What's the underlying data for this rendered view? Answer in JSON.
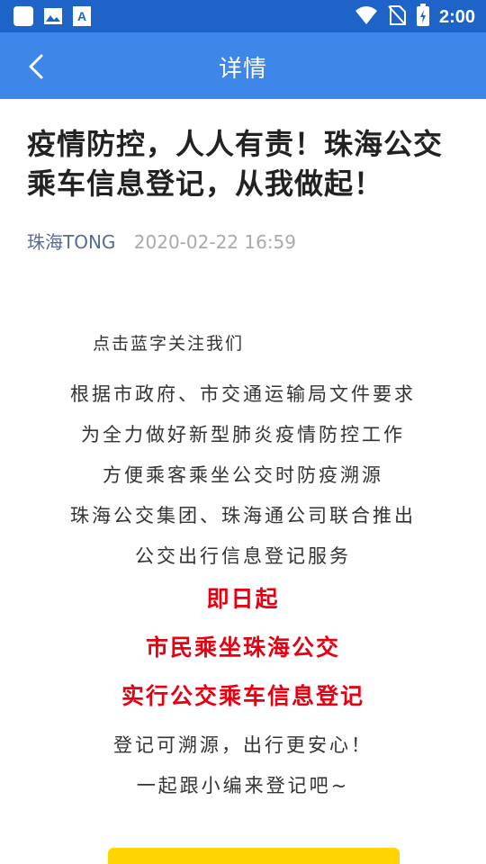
{
  "status_bar": {
    "time": "2:00",
    "icons": [
      "square-icon",
      "image-icon",
      "a-text-icon",
      "wifi-icon",
      "no-sim-icon",
      "battery-icon"
    ]
  },
  "app_bar": {
    "title": "详情",
    "back_icon": "chevron-left-icon",
    "color": "#3e86e7"
  },
  "article": {
    "title": "疫情防控，人人有责！珠海公交乘车信息登记，从我做起！",
    "author": "珠海TONG",
    "date": "2020-02-22 16:59",
    "lines": [
      "点击蓝字关注我们",
      "根据市政府、市交通运输局文件要求",
      "为全力做好新型肺炎疫情防控工作",
      "方便乘客乘坐公交时防疫溯源",
      "珠海公交集团、珠海通公司联合推出",
      "公交出行信息登记服务",
      "即日起",
      "市民乘坐珠海公交",
      "实行公交乘车信息登记",
      "登记可溯源，出行更安心！",
      "一起跟小编来登记吧~"
    ],
    "highlight_color": "#e60012"
  }
}
